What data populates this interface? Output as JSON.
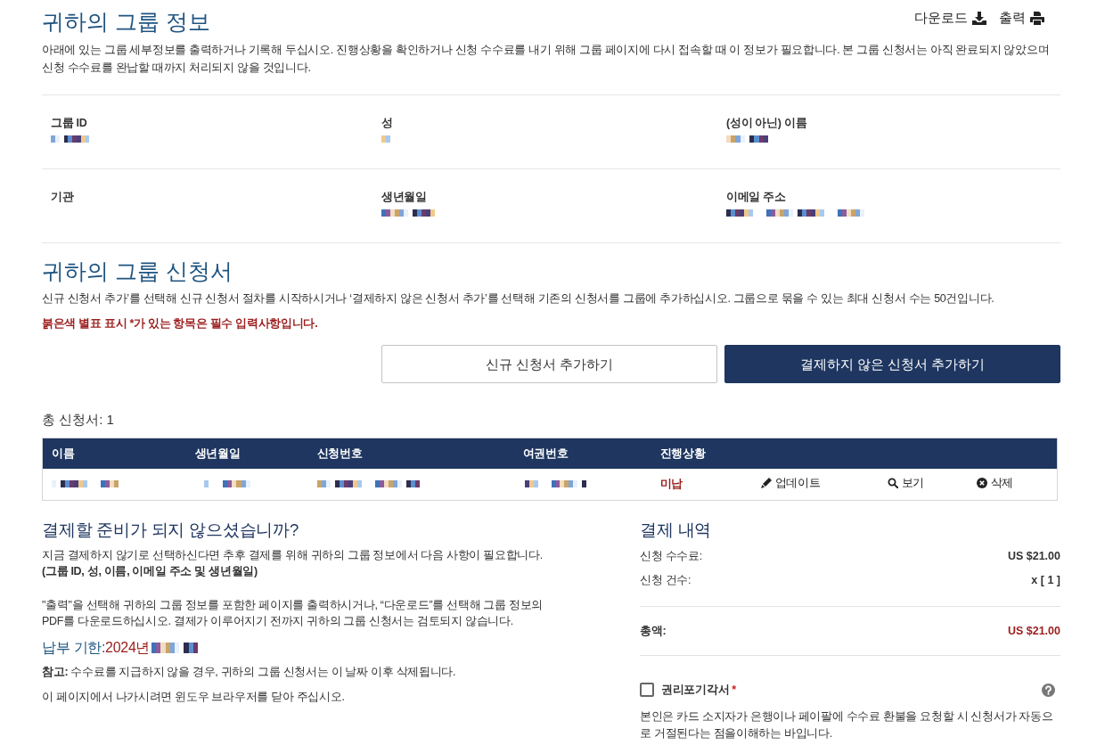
{
  "header": {
    "title": "귀하의 그룹 정보",
    "actions": [
      {
        "label": "다운로드",
        "kind": "download"
      },
      {
        "label": "출력",
        "kind": "print"
      }
    ],
    "description": "아래에 있는 그룹 세부정보를 출력하거나 기록해 두십시오. 진행상황을 확인하거나 신청 수수료를 내기 위해 그룹 페이지에 다시 접속할 때 이 정보가 필요합니다. 본 그룹 신청서는 아직 완료되지 않았으며 신청 수수료를 완납할 때까지 처리되지 않을 것입니다."
  },
  "group_info": {
    "rows": [
      [
        {
          "label": "그룹 ID",
          "redacted": true
        },
        {
          "label": "성",
          "redacted": true
        },
        {
          "label": "(성이 아닌) 이름",
          "redacted": true
        }
      ],
      [
        {
          "label": "기관",
          "redacted": false
        },
        {
          "label": "생년월일",
          "redacted": true
        },
        {
          "label": "이메일 주소",
          "redacted": true
        }
      ]
    ]
  },
  "applications": {
    "title": "귀하의 그룹 신청서",
    "description": "신규 신청서 추가’를 선택해 신규 신청서 절차를 시작하시거나 ‘결제하지 않은 신청서 추가’를 선택해 기존의 신청서를 그룹에 추가하십시오. 그룹으로 묶을 수 있는 최대 신청서 수는 50건입니다.",
    "required_note": "붉은색 별표 표시 *가 있는 항목은 필수 입력사항입니다.",
    "buttons": [
      {
        "label": "신규 신청서 추가하기",
        "kind": "outline"
      },
      {
        "label": "결제하지 않은 신청서 추가하기",
        "kind": "solid"
      }
    ],
    "total": "총 신청서: 1"
  },
  "table": {
    "columns": [
      "이름",
      "생년월일",
      "신청번호",
      "여권번호",
      "진행상황"
    ],
    "rows": [
      {
        "cells": [
          {
            "redacted": true
          },
          {
            "redacted": true
          },
          {
            "redacted": true
          },
          {
            "redacted": true
          }
        ],
        "status": "미납",
        "actions": [
          {
            "label": "업데이트",
            "kind": "edit"
          },
          {
            "label": "보기",
            "kind": "view"
          },
          {
            "label": "삭제",
            "kind": "delete"
          }
        ]
      }
    ]
  },
  "not_ready": {
    "title": "결제할 준비가 되지 않으셨습니까?",
    "paragraphs": [
      "지금 결제하지 않기로 선택하신다면 추후 결제를 위해 귀하의 그룹 정보에서 다음 사항이 필요합니다. **(그룹 ID, 성, 이름, 이메일 주소 및 생년월일)**",
      "\"출력\"을 선택해 귀하의 그룹 정보를 포함한 페이지를 출력하시거나, “다운로드”를 선택해 그룹 정보의 PDF를 다운로드하십시오. 결제가 이루어지기 전까지 귀하의 그룹 신청서는 검토되지 않습니다."
    ],
    "deadline": {
      "label": "납부 기한:",
      "value": "2024년",
      "redacted": true
    },
    "note": "**참고:** 수수료를 지급하지 않을 경우, 귀하의 그룹 신청서는 이 날짜 이후 삭제됩니다.",
    "exit_note": "이 페이지에서 나가시려면 윈도우 브라우저를 닫아 주십시오."
  },
  "payment": {
    "title": "결제 내역",
    "lines": [
      {
        "label": "신청 수수료:",
        "value": "US $21.00"
      },
      {
        "label": "신청 건수:",
        "value": "x [ 1 ]"
      }
    ],
    "total": {
      "label": "총액:",
      "value": "US $21.00"
    },
    "waiver": {
      "label": "권리포기각서",
      "required_mark": "*",
      "checked": false,
      "text": "본인은 카드 소지자가 은행이나 페이팔에 수수료 환불을 요청할 시 신청서가 자동으로 거절된다는 점을이해하는 바입니다."
    }
  }
}
